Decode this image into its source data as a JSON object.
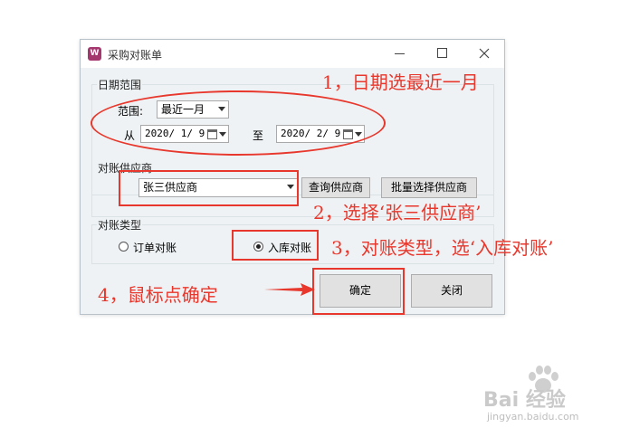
{
  "window": {
    "title": "采购对账单"
  },
  "date_range": {
    "group_label": "日期范围",
    "range_label": "范围:",
    "range_value": "最近一月",
    "from_label": "从",
    "from_date": "2020/ 1/ 9",
    "to_label": "至",
    "to_date": "2020/ 2/ 9"
  },
  "supplier": {
    "group_label": "对账供应商",
    "value": "张三供应商",
    "query_button": "查询供应商",
    "batch_button": "批量选择供应商"
  },
  "reconcile_type": {
    "group_label": "对账类型",
    "options": [
      "订单对账",
      "入库对账"
    ],
    "selected": "入库对账"
  },
  "actions": {
    "confirm": "确定",
    "close": "关闭"
  },
  "annotations": {
    "step1": "1，日期选最近一月",
    "step2": "2，选择‘张三供应商’",
    "step3": "3，对账类型，选‘入库对账’",
    "step4": "4，鼠标点确定"
  },
  "watermark": {
    "brand": "Bai 经验",
    "url": "jingyan.baidu.com"
  },
  "colors": {
    "annotation": "#e8372c",
    "dialog_bg": "#eef2f4"
  }
}
